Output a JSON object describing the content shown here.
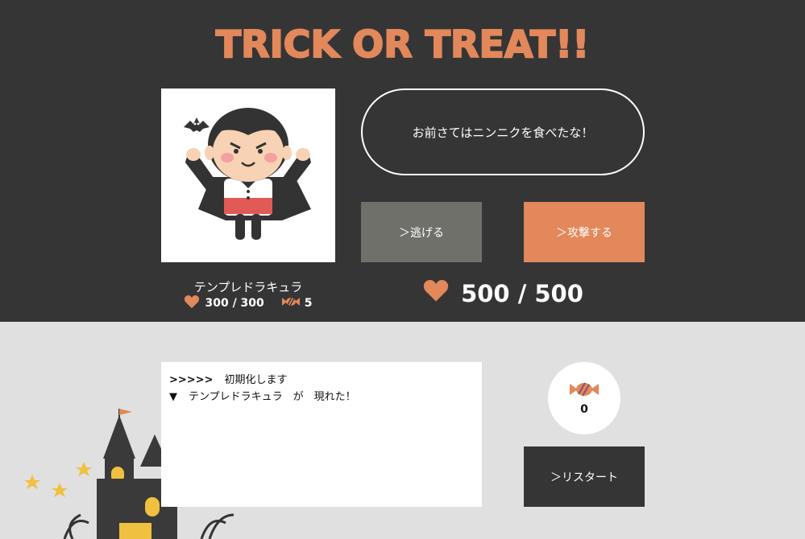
{
  "title": "TRICK OR TREAT!!",
  "enemy": {
    "name": "テンプレドラキュラ",
    "hp": "300 / 300",
    "candy": "5"
  },
  "dialogue": "お前さてはニンニクを食べたな！",
  "buttons": {
    "flee": "＞逃げる",
    "attack": "＞攻撃する",
    "restart": "＞リスタート"
  },
  "player": {
    "hp": "500 / 500",
    "candy_count": "0"
  },
  "log": [
    {
      "prefix": ">>>>>",
      "text": "初期化します"
    },
    {
      "prefix": "▼",
      "text": "テンプレドラキュラ　が　現れた！"
    }
  ],
  "colors": {
    "accent": "#e2885a",
    "dark": "#353535",
    "grey_button": "#70706b",
    "light_bg": "#e0e0e0"
  },
  "icons": [
    "heart-icon",
    "candy-icon",
    "bat-icon"
  ]
}
